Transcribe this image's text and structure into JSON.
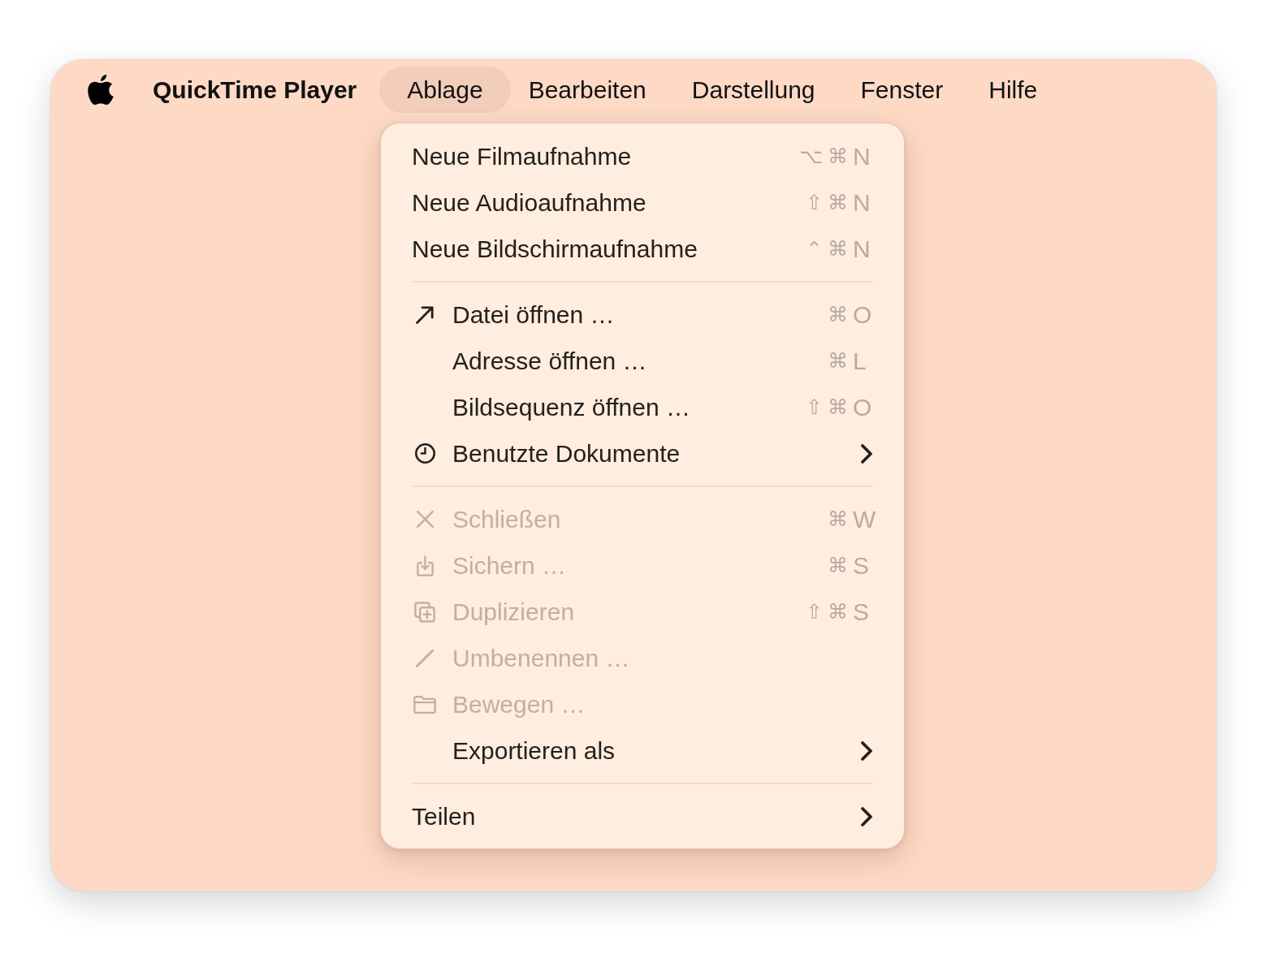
{
  "menu_bar": {
    "app_name": "QuickTime Player",
    "menus": [
      {
        "label": "Ablage",
        "selected": true
      },
      {
        "label": "Bearbeiten",
        "selected": false
      },
      {
        "label": "Darstellung",
        "selected": false
      },
      {
        "label": "Fenster",
        "selected": false
      },
      {
        "label": "Hilfe",
        "selected": false
      }
    ]
  },
  "menu": {
    "sections": [
      {
        "items": [
          {
            "label": "Neue Filmaufnahme",
            "shortcut": {
              "modifiers": "⌥⌘",
              "key": "N"
            },
            "disabled": false,
            "submenu": false
          },
          {
            "label": "Neue Audioaufnahme",
            "shortcut": {
              "modifiers": "⇧⌘",
              "key": "N"
            },
            "disabled": false,
            "submenu": false
          },
          {
            "label": "Neue Bildschirmaufnahme",
            "shortcut": {
              "modifiers": "⌃⌘",
              "key": "N"
            },
            "disabled": false,
            "submenu": false
          }
        ]
      },
      {
        "items": [
          {
            "label": "Datei öffnen …",
            "shortcut": {
              "modifiers": "⌘",
              "key": "O"
            },
            "disabled": false,
            "submenu": false
          },
          {
            "label": "Adresse öffnen …",
            "shortcut": {
              "modifiers": "⌘",
              "key": "L"
            },
            "disabled": false,
            "submenu": false
          },
          {
            "label": "Bildsequenz öffnen …",
            "shortcut": {
              "modifiers": "⇧⌘",
              "key": "O"
            },
            "disabled": false,
            "submenu": false
          },
          {
            "label": "Benutzte Dokumente",
            "disabled": false,
            "submenu": true
          }
        ]
      },
      {
        "items": [
          {
            "label": "Schließen",
            "shortcut": {
              "modifiers": "⌘",
              "key": "W"
            },
            "disabled": true,
            "submenu": false
          },
          {
            "label": "Sichern …",
            "shortcut": {
              "modifiers": "⌘",
              "key": "S"
            },
            "disabled": true,
            "submenu": false
          },
          {
            "label": "Duplizieren",
            "shortcut": {
              "modifiers": "⇧⌘",
              "key": "S"
            },
            "disabled": true,
            "submenu": false
          },
          {
            "label": "Umbenennen …",
            "disabled": true,
            "submenu": false
          },
          {
            "label": "Bewegen …",
            "disabled": true,
            "submenu": false
          },
          {
            "label": "Exportieren als",
            "disabled": false,
            "submenu": true
          }
        ]
      },
      {
        "items": [
          {
            "label": "Teilen",
            "disabled": false,
            "submenu": true
          }
        ]
      }
    ]
  }
}
